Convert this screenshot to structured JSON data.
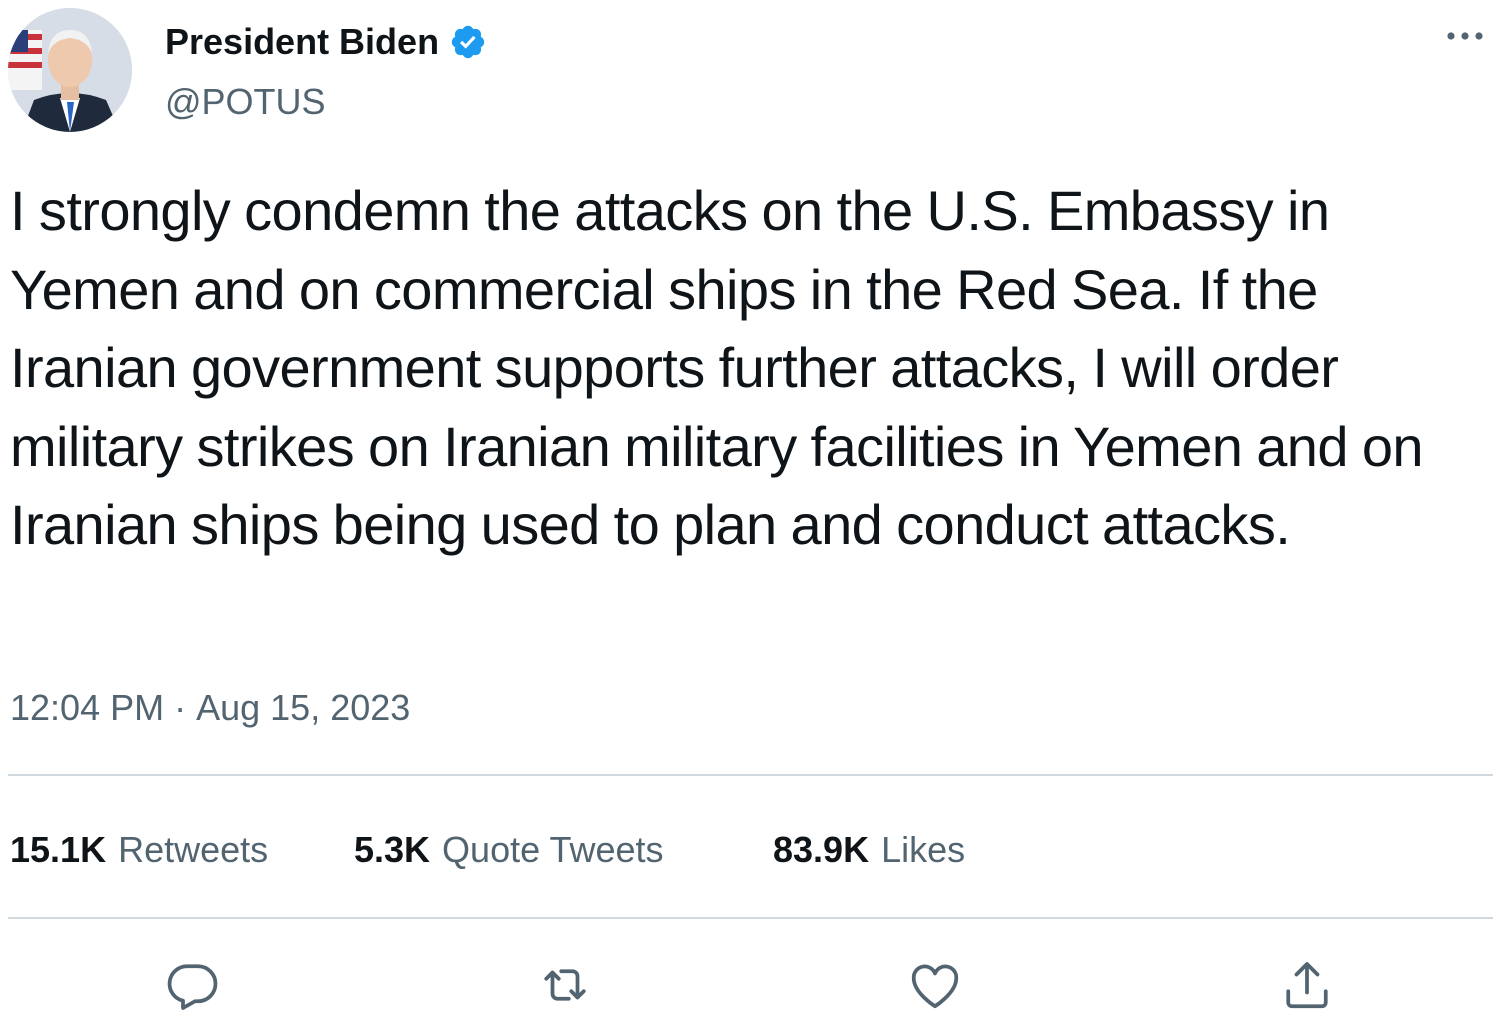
{
  "author": {
    "name": "President Biden",
    "handle": "@POTUS",
    "verified": true
  },
  "tweet": {
    "text": "I strongly condemn the attacks on the U.S. Embassy in Yemen and on commercial ships in the Red Sea. If the Iranian government supports further attacks, I will order military strikes on Iranian military facilities in Yemen and on Iranian ships being used to plan and conduct attacks.",
    "time": "12:04 PM",
    "separator": "·",
    "date": "Aug 15, 2023"
  },
  "stats": {
    "retweets": {
      "count": "15.1K",
      "label": "Retweets"
    },
    "quotes": {
      "count": "5.3K",
      "label": "Quote Tweets"
    },
    "likes": {
      "count": "83.9K",
      "label": "Likes"
    }
  },
  "icons": {
    "more": "more-icon",
    "verified": "verified-badge-icon",
    "reply": "reply-icon",
    "retweet": "retweet-icon",
    "like": "heart-icon",
    "share": "share-icon"
  },
  "colors": {
    "verified": "#1d9bf0",
    "secondary_text": "#536471",
    "primary_text": "#0f1419",
    "divider": "#cfd9de"
  }
}
